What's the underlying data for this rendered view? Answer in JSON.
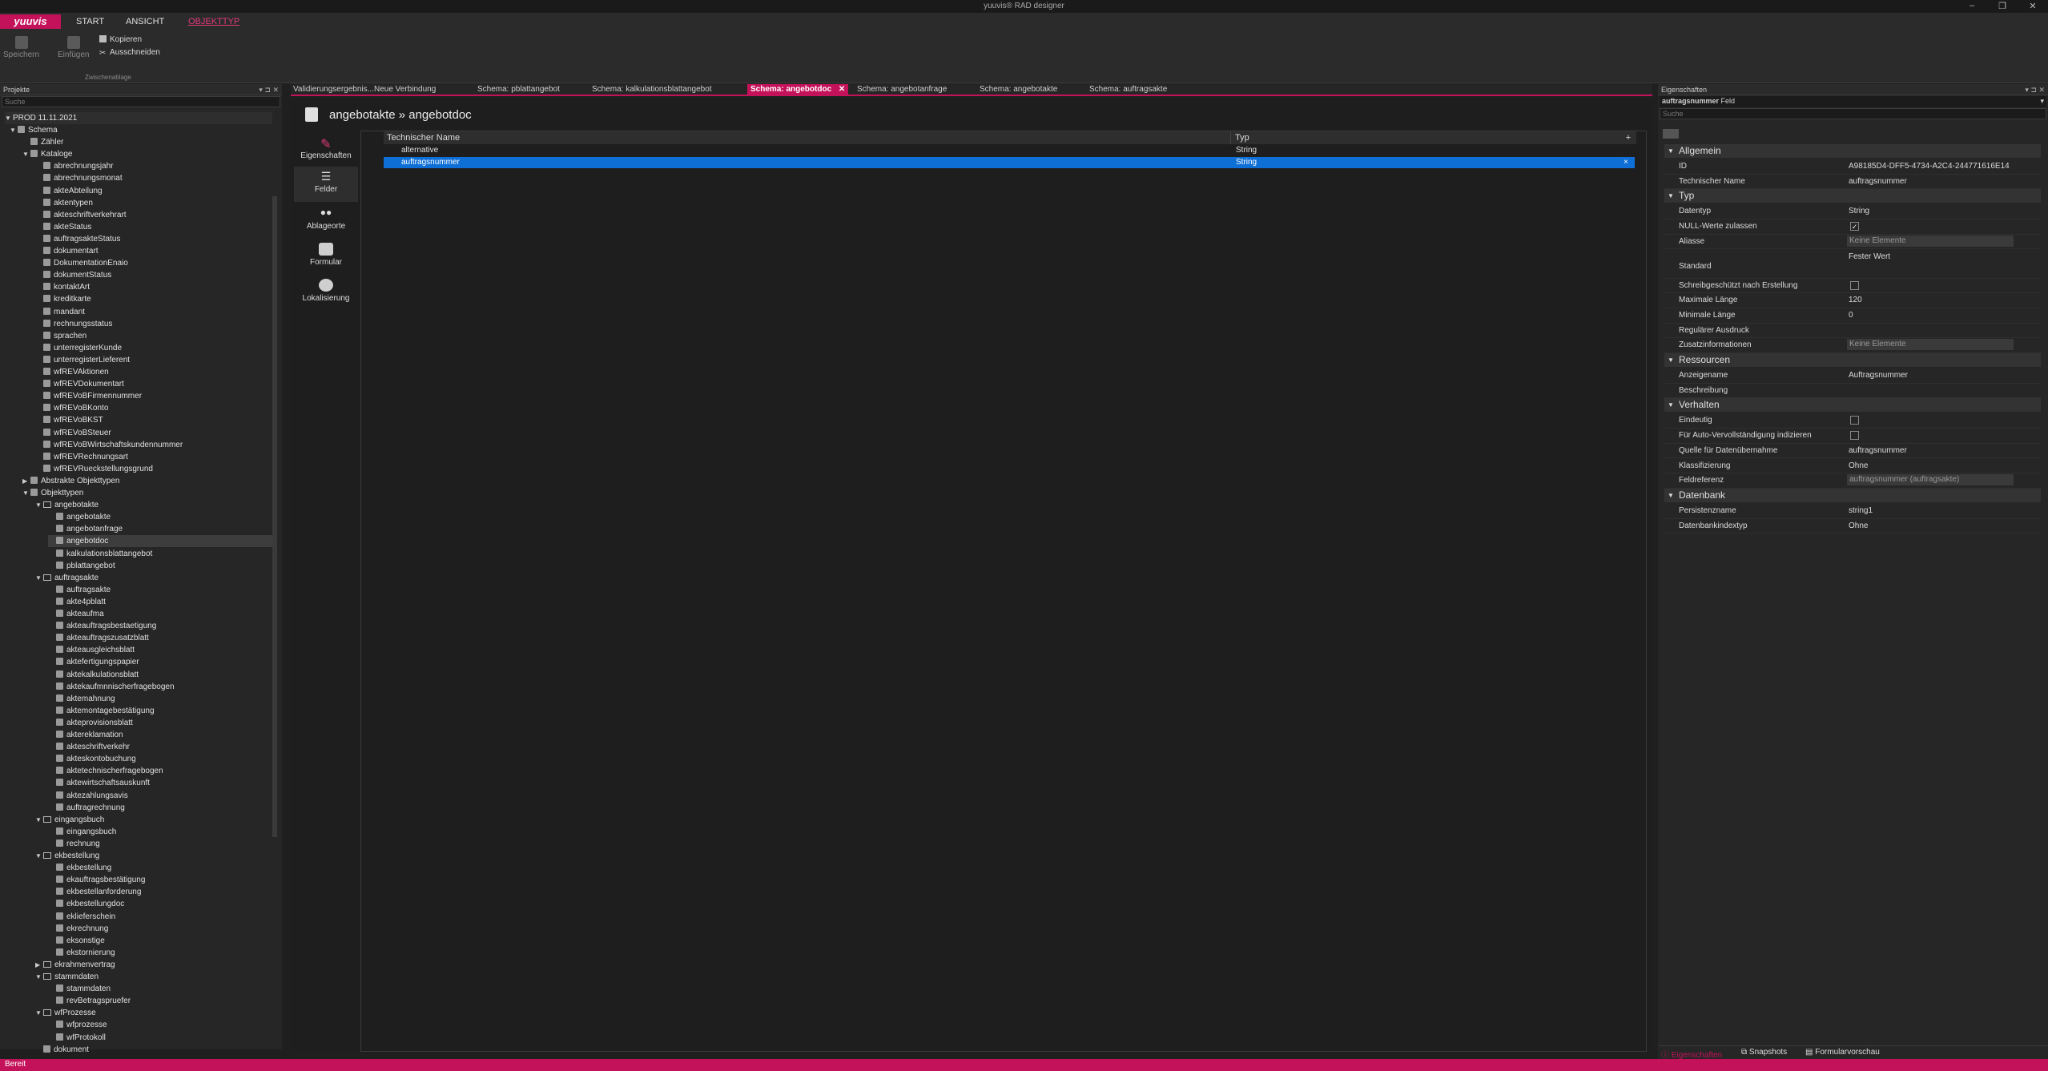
{
  "window": {
    "title": "yuuvis® RAD designer"
  },
  "menu": {
    "logo": "yuuvis",
    "items": [
      "START",
      "ANSICHT",
      "OBJEKTTYP"
    ]
  },
  "ribbon": {
    "save": "Speichern",
    "paste": "Einfügen",
    "copy": "Kopieren",
    "cut": "Ausschneiden",
    "group": "Zwischenablage"
  },
  "projects": {
    "header": "Projekte",
    "search": "Suche",
    "root": "PROD 11.11.2021",
    "nodes": [
      {
        "l": 0,
        "t": "Schema",
        "e": "v"
      },
      {
        "l": 1,
        "t": "Zähler"
      },
      {
        "l": 1,
        "t": "Kataloge",
        "e": "v"
      },
      {
        "l": 2,
        "t": "abrechnungsjahr"
      },
      {
        "l": 2,
        "t": "abrechnungsmonat"
      },
      {
        "l": 2,
        "t": "akteAbteilung"
      },
      {
        "l": 2,
        "t": "aktentypen"
      },
      {
        "l": 2,
        "t": "akteschriftverkehrart"
      },
      {
        "l": 2,
        "t": "akteStatus"
      },
      {
        "l": 2,
        "t": "auftragsakteStatus"
      },
      {
        "l": 2,
        "t": "dokumentart"
      },
      {
        "l": 2,
        "t": "DokumentationEnaio"
      },
      {
        "l": 2,
        "t": "dokumentStatus"
      },
      {
        "l": 2,
        "t": "kontaktArt"
      },
      {
        "l": 2,
        "t": "kreditkarte"
      },
      {
        "l": 2,
        "t": "mandant"
      },
      {
        "l": 2,
        "t": "rechnungsstatus"
      },
      {
        "l": 2,
        "t": "sprachen"
      },
      {
        "l": 2,
        "t": "unterregisterKunde"
      },
      {
        "l": 2,
        "t": "unterregisterLieferent"
      },
      {
        "l": 2,
        "t": "wfREVAktionen"
      },
      {
        "l": 2,
        "t": "wfREVDokumentart"
      },
      {
        "l": 2,
        "t": "wfREVoBFirmennummer"
      },
      {
        "l": 2,
        "t": "wfREVoBKonto"
      },
      {
        "l": 2,
        "t": "wfREVoBKST"
      },
      {
        "l": 2,
        "t": "wfREVoBSteuer"
      },
      {
        "l": 2,
        "t": "wfREVoBWirtschaftskundennummer"
      },
      {
        "l": 2,
        "t": "wfREVRechnungsart"
      },
      {
        "l": 2,
        "t": "wfREVRueckstellungsgrund"
      },
      {
        "l": 1,
        "t": "Abstrakte Objekttypen",
        "e": ">"
      },
      {
        "l": 1,
        "t": "Objekttypen",
        "e": "v"
      },
      {
        "l": 2,
        "t": "angebotakte",
        "e": "v",
        "f": 1
      },
      {
        "l": 3,
        "t": "angebotakte"
      },
      {
        "l": 3,
        "t": "angebotanfrage"
      },
      {
        "l": 3,
        "t": "angebotdoc",
        "s": 1
      },
      {
        "l": 3,
        "t": "kalkulationsblattangebot"
      },
      {
        "l": 3,
        "t": "pblattangebot"
      },
      {
        "l": 2,
        "t": "auftragsakte",
        "e": "v",
        "f": 1
      },
      {
        "l": 3,
        "t": "auftragsakte"
      },
      {
        "l": 3,
        "t": "akte4pblatt"
      },
      {
        "l": 3,
        "t": "akteaufma"
      },
      {
        "l": 3,
        "t": "akteauftragsbestaetigung"
      },
      {
        "l": 3,
        "t": "akteauftragszusatzblatt"
      },
      {
        "l": 3,
        "t": "akteausgleichsblatt"
      },
      {
        "l": 3,
        "t": "aktefertigungspapier"
      },
      {
        "l": 3,
        "t": "aktekalkulationsblatt"
      },
      {
        "l": 3,
        "t": "aktekaufmnnischerfragebogen"
      },
      {
        "l": 3,
        "t": "aktemahnung"
      },
      {
        "l": 3,
        "t": "aktemontagebestätigung"
      },
      {
        "l": 3,
        "t": "akteprovisionsblatt"
      },
      {
        "l": 3,
        "t": "aktereklamation"
      },
      {
        "l": 3,
        "t": "akteschriftverkehr"
      },
      {
        "l": 3,
        "t": "akteskontobuchung"
      },
      {
        "l": 3,
        "t": "aktetechnischerfragebogen"
      },
      {
        "l": 3,
        "t": "aktewirtschaftsauskunft"
      },
      {
        "l": 3,
        "t": "aktezahlungsavis"
      },
      {
        "l": 3,
        "t": "auftragrechnung"
      },
      {
        "l": 2,
        "t": "eingangsbuch",
        "e": "v",
        "f": 1
      },
      {
        "l": 3,
        "t": "eingangsbuch"
      },
      {
        "l": 3,
        "t": "rechnung"
      },
      {
        "l": 2,
        "t": "ekbestellung",
        "e": "v",
        "f": 1
      },
      {
        "l": 3,
        "t": "ekbestellung"
      },
      {
        "l": 3,
        "t": "ekauftragsbestätigung"
      },
      {
        "l": 3,
        "t": "ekbestellanforderung"
      },
      {
        "l": 3,
        "t": "ekbestellungdoc"
      },
      {
        "l": 3,
        "t": "eklieferschein"
      },
      {
        "l": 3,
        "t": "ekrechnung"
      },
      {
        "l": 3,
        "t": "eksonstige"
      },
      {
        "l": 3,
        "t": "ekstornierung"
      },
      {
        "l": 2,
        "t": "ekrahmenvertrag",
        "e": ">",
        "f": 1
      },
      {
        "l": 2,
        "t": "stammdaten",
        "e": "v",
        "f": 1
      },
      {
        "l": 3,
        "t": "stammdaten"
      },
      {
        "l": 3,
        "t": "revBetragspruefer"
      },
      {
        "l": 2,
        "t": "wfProzesse",
        "e": "v",
        "f": 1
      },
      {
        "l": 3,
        "t": "wfprozesse"
      },
      {
        "l": 3,
        "t": "wfProtokoll"
      },
      {
        "l": 2,
        "t": "dokument"
      }
    ]
  },
  "tabs": [
    "Validierungsergebnis...Neue Verbindung",
    "Schema: pblattangebot",
    "Schema: kalkulationsblattangebot",
    "Schema: angebotdoc",
    "Schema: angebotanfrage",
    "Schema: angebotakte",
    "Schema: auftragsakte"
  ],
  "editor": {
    "breadcrumb": "angebotakte » angebotdoc",
    "nav": [
      "Eigenschaften",
      "Felder",
      "Ablageorte",
      "Formular",
      "Lokalisierung"
    ],
    "columns": [
      "Technischer Name",
      "Typ"
    ],
    "rows": [
      {
        "name": "alternative",
        "type": "String"
      },
      {
        "name": "auftragsnummer",
        "type": "String"
      }
    ]
  },
  "props": {
    "header": "Eigenschaften",
    "selected_name": "auftragsnummer",
    "selected_kind": "Feld",
    "search": "Suche",
    "sections": [
      {
        "title": "Allgemein",
        "rows": [
          {
            "k": "ID",
            "v": "A98185D4-DFF5-4734-A2C4-244771616E14"
          },
          {
            "k": "Technischer Name",
            "v": "auftragsnummer"
          }
        ]
      },
      {
        "title": "Typ",
        "rows": [
          {
            "k": "Datentyp",
            "v": "String"
          },
          {
            "k": "NULL-Werte zulassen",
            "chk": "✓"
          },
          {
            "k": "Aliasse",
            "box": "Keine Elemente"
          },
          {
            "k": "Standard",
            "v": "Fester Wert",
            "tall": 1
          },
          {
            "k": "Schreibgeschützt nach Erstellung",
            "chk": ""
          },
          {
            "k": "Maximale Länge",
            "v": "120"
          },
          {
            "k": "Minimale Länge",
            "v": "0"
          },
          {
            "k": "Regulärer Ausdruck",
            "v": ""
          },
          {
            "k": "Zusatzinformationen",
            "box": "Keine Elemente"
          }
        ]
      },
      {
        "title": "Ressourcen",
        "rows": [
          {
            "k": "Anzeigename",
            "v": "Auftragsnummer"
          },
          {
            "k": "Beschreibung",
            "v": ""
          }
        ]
      },
      {
        "title": "Verhalten",
        "rows": [
          {
            "k": "Eindeutig",
            "chk": ""
          },
          {
            "k": "Für Auto-Vervollständigung indizieren",
            "chk": ""
          },
          {
            "k": "Quelle für Datenübernahme",
            "v": "auftragsnummer"
          },
          {
            "k": "Klassifizierung",
            "v": "Ohne"
          },
          {
            "k": "Feldreferenz",
            "box": "auftragsnummer (auftragsakte)"
          }
        ]
      },
      {
        "title": "Datenbank",
        "rows": [
          {
            "k": "Persistenzname",
            "v": "string1"
          },
          {
            "k": "Datenbankindextyp",
            "v": "Ohne"
          }
        ]
      }
    ],
    "bottom_tabs": [
      "Eigenschaften",
      "Snapshots",
      "Formularvorschau"
    ]
  },
  "status": "Bereit"
}
